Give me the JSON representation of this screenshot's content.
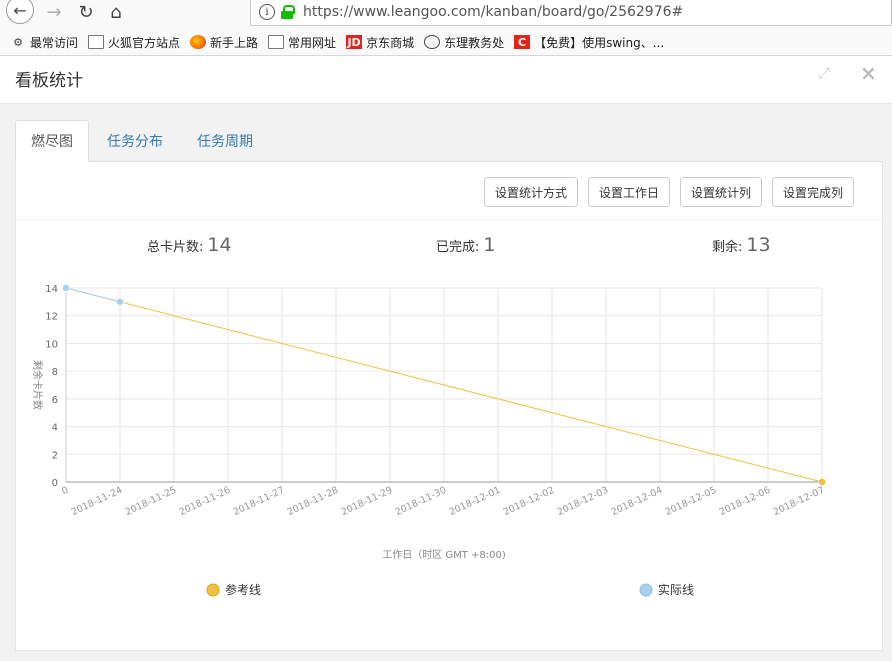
{
  "browser": {
    "url": "https://www.leangoo.com/kanban/board/go/2562976#",
    "bookmarks": [
      "最常访问",
      "火狐官方站点",
      "新手上路",
      "常用网址",
      "京东商城",
      "东理教务处",
      "【免费】使用swing、..."
    ]
  },
  "modal": {
    "title": "看板统计",
    "tabs": [
      "燃尽图",
      "任务分布",
      "任务周期"
    ],
    "buttons": [
      "设置统计方式",
      "设置工作日",
      "设置统计列",
      "设置完成列"
    ]
  },
  "stats": {
    "total_label": "总卡片数:",
    "total_value": "14",
    "done_label": "已完成:",
    "done_value": "1",
    "remain_label": "剩余:",
    "remain_value": "13"
  },
  "chart_data": {
    "type": "line",
    "xlabel": "工作日（时区 GMT +8:00)",
    "ylabel": "剩余卡片数",
    "ylim": [
      0,
      14
    ],
    "yticks": [
      0,
      2,
      4,
      6,
      8,
      10,
      12,
      14
    ],
    "x": [
      "0",
      "2018-11-24",
      "2018-11-25",
      "2018-11-26",
      "2018-11-27",
      "2018-11-28",
      "2018-11-29",
      "2018-11-30",
      "2018-12-01",
      "2018-12-02",
      "2018-12-03",
      "2018-12-04",
      "2018-12-05",
      "2018-12-06",
      "2018-12-07"
    ],
    "grid": true,
    "series": [
      {
        "name": "参考线",
        "color": "#f0c040",
        "x": [
          "0",
          "2018-12-07"
        ],
        "values": [
          14,
          0
        ]
      },
      {
        "name": "实际线",
        "color": "#a8d0ec",
        "x": [
          "0",
          "2018-11-24"
        ],
        "values": [
          14,
          13
        ]
      }
    ],
    "legend": "bottom"
  }
}
